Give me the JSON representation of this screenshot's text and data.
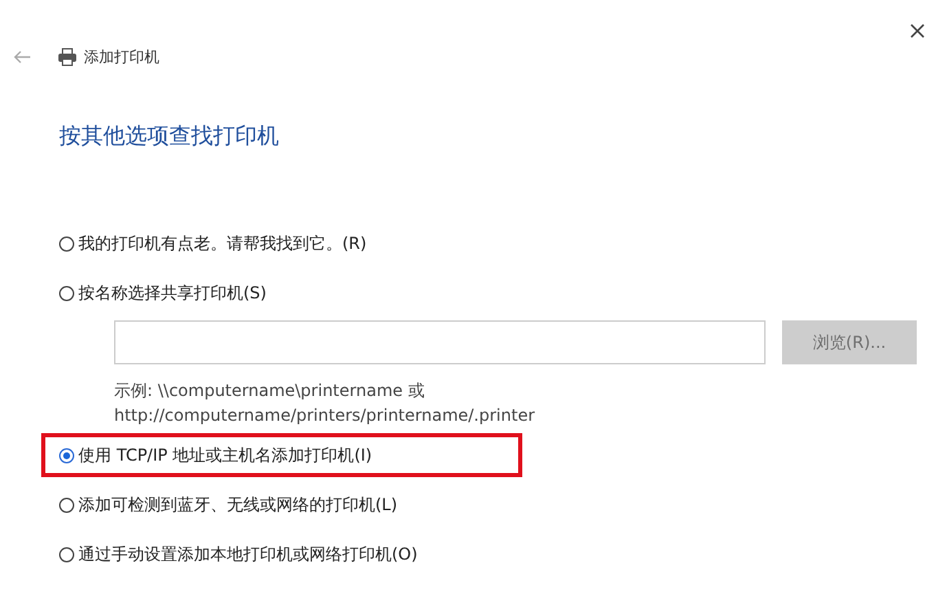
{
  "window": {
    "title": "添加打印机"
  },
  "heading": "按其他选项查找打印机",
  "options": [
    {
      "kind": "plain",
      "label": "我的打印机有点老。请帮我找到它。(R)",
      "selected": false,
      "highlighted": false
    },
    {
      "kind": "share",
      "label": "按名称选择共享打印机(S)",
      "selected": false,
      "highlighted": false,
      "browse": {
        "label": "浏览(R)...",
        "disabled": true
      },
      "example": [
        "示例: \\\\computername\\printername 或",
        "http://computername/printers/printername/.printer"
      ]
    },
    {
      "kind": "plain",
      "label": "使用 TCP/IP 地址或主机名添加打印机(I)",
      "selected": true,
      "highlighted": true
    },
    {
      "kind": "plain",
      "label": "添加可检测到蓝牙、无线或网络的打印机(L)",
      "selected": false,
      "highlighted": false
    },
    {
      "kind": "plain",
      "label": "通过手动设置添加本地打印机或网络打印机(O)",
      "selected": false,
      "highlighted": false
    }
  ]
}
